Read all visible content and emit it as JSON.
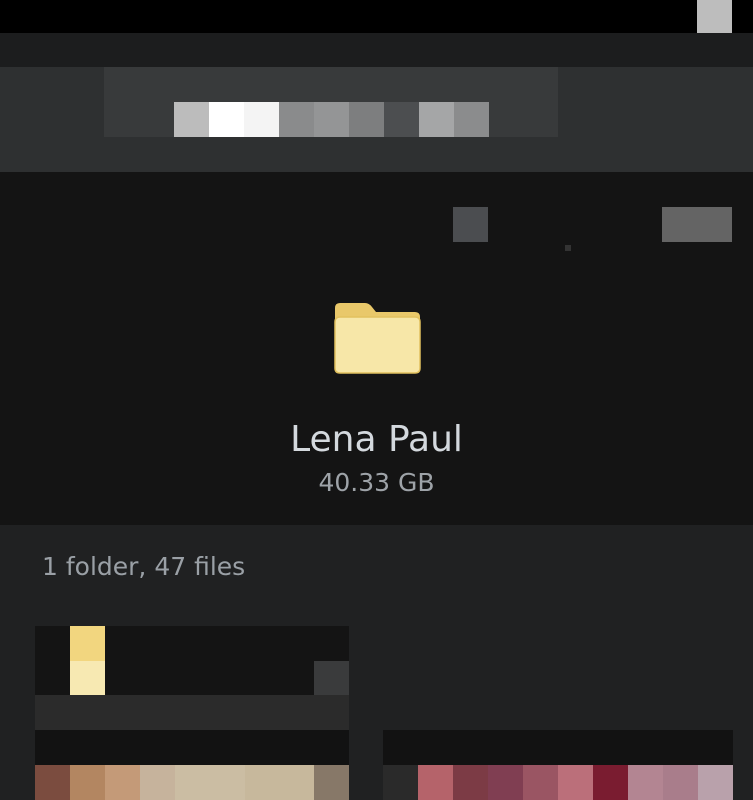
{
  "folder": {
    "name": "Lena Paul",
    "size": "40.33 GB",
    "icon": "folder-icon",
    "icon_color": "#f5e4a0"
  },
  "listing": {
    "summary": "1 folder, 47 files"
  },
  "colors": {
    "background": "#202122",
    "hero_background": "#141414",
    "header_background": "#2e3031",
    "title_text": "#d4d9de",
    "secondary_text": "#9aa0a6"
  }
}
